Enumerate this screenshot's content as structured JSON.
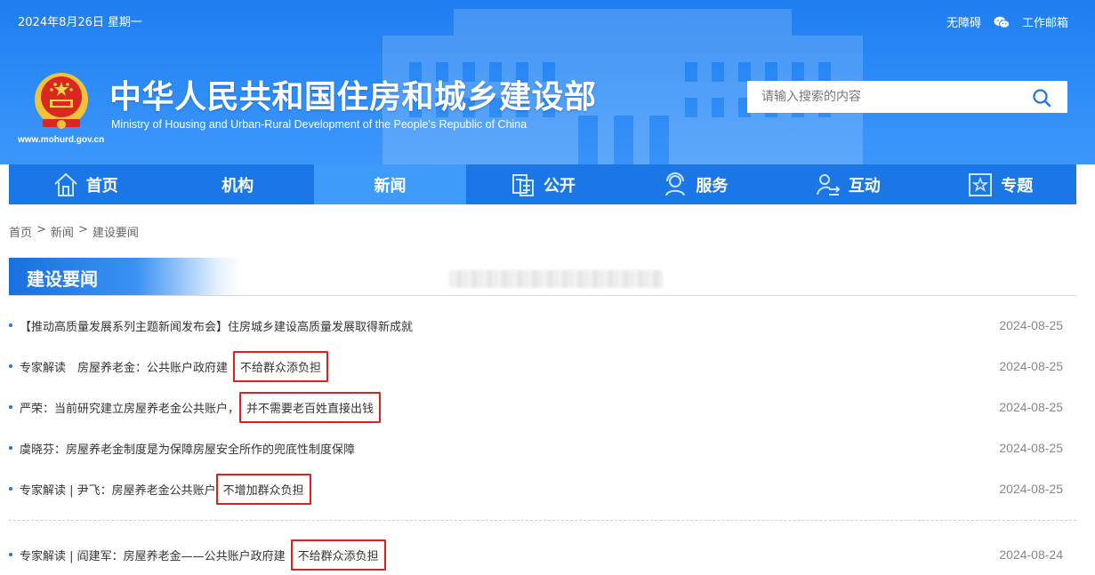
{
  "header": {
    "date": "2024年8月26日 星期一",
    "links": {
      "accessibility": "无障碍",
      "mail": "工作邮箱"
    },
    "title_cn": "中华人民共和国住房和城乡建设部",
    "title_en": "Ministry of Housing and Urban-Rural Development of the People's Republic of China",
    "site_url": "www.mohurd.gov.cn",
    "search": {
      "placeholder": "请输入搜索的内容",
      "value": ""
    }
  },
  "nav": {
    "items": [
      {
        "label": "首页",
        "icon": "home-icon"
      },
      {
        "label": "机构",
        "icon": ""
      },
      {
        "label": "新闻",
        "icon": "",
        "active": true
      },
      {
        "label": "公开",
        "icon": "document-icon"
      },
      {
        "label": "服务",
        "icon": "service-person-icon"
      },
      {
        "label": "互动",
        "icon": "interaction-person-icon"
      },
      {
        "label": "专题",
        "icon": "star-box-icon"
      }
    ]
  },
  "breadcrumb": {
    "home": "首页",
    "news": "新闻",
    "current": "建设要闻",
    "sep": ">"
  },
  "section": {
    "title": "建设要闻"
  },
  "news": [
    {
      "prefix": "【推动高质量发展系列主题新闻发布会】住房城乡建设高质量发展取得新成就",
      "highlight": "",
      "date": "2024-08-25"
    },
    {
      "prefix": "专家解读　房屋养老金：公共账户政府建",
      "highlight": "不给群众添负担",
      "date": "2024-08-25"
    },
    {
      "prefix": "严荣：当前研究建立房屋养老金公共账户，",
      "highlight": "并不需要老百姓直接出钱",
      "date": "2024-08-25"
    },
    {
      "prefix": "虞晓芬：房屋养老金制度是为保障房屋安全所作的兜底性制度保障",
      "highlight": "",
      "date": "2024-08-25"
    },
    {
      "prefix": "专家解读 | 尹飞：房屋养老金公共账户",
      "highlight": "不增加群众负担",
      "date": "2024-08-25"
    },
    {
      "prefix": "专家解读 | 阎建军：房屋养老金——公共账户政府建",
      "highlight": "不给群众添负担",
      "date": "2024-08-24"
    }
  ],
  "colors": {
    "primary": "#1b76e6",
    "nav_active": "#3f9bf9",
    "highlight_border": "#e02020"
  }
}
